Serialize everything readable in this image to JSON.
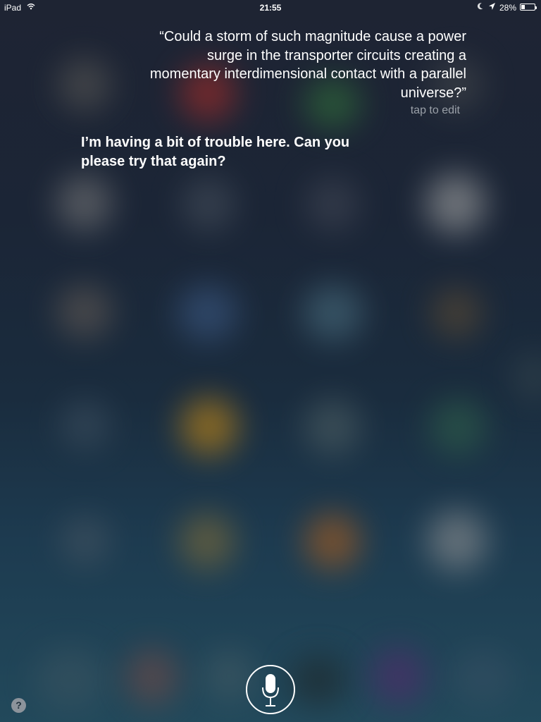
{
  "status_bar": {
    "device": "iPad",
    "time": "21:55",
    "battery": "28%",
    "battery_level": 0.28,
    "icons": [
      "wifi-icon",
      "moon-icon",
      "location-arrow-icon",
      "battery-icon"
    ]
  },
  "siri": {
    "user_query": "“Could a storm of such magnitude cause a power surge in the transporter circuits creating a momentary interdimensional contact with a parallel universe?”",
    "tap_to_edit": "tap to edit",
    "response": "I’m having a bit of trouble here. Can you please try that again?",
    "mic_icon": "microphone-icon",
    "help_label": "?"
  },
  "background": {
    "description_colors": {
      "base_top": "#1e2433",
      "base_bottom": "#22495b",
      "text": "#ffffff",
      "secondary_text": "#9aa0a8"
    }
  }
}
